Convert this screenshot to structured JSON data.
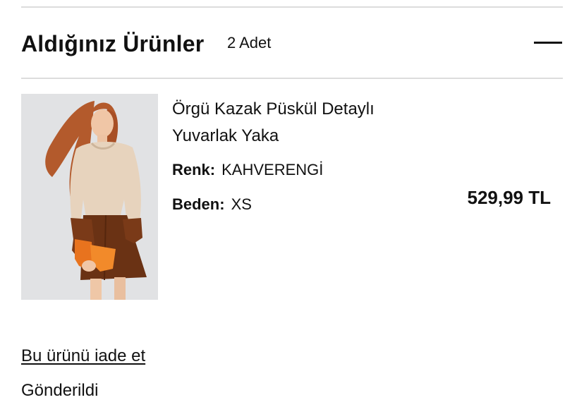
{
  "section": {
    "title": "Aldığınız Ürünler",
    "count": "2 Adet"
  },
  "product": {
    "name": "Örgü Kazak Püskül Detaylı Yuvarlak Yaka",
    "color_label": "Renk:",
    "color_value": "KAHVERENGİ",
    "size_label": "Beden:",
    "size_value": "XS",
    "price": "529,99 TL"
  },
  "actions": {
    "return_label": "Bu ürünü iade et"
  },
  "status": "Gönderildi"
}
